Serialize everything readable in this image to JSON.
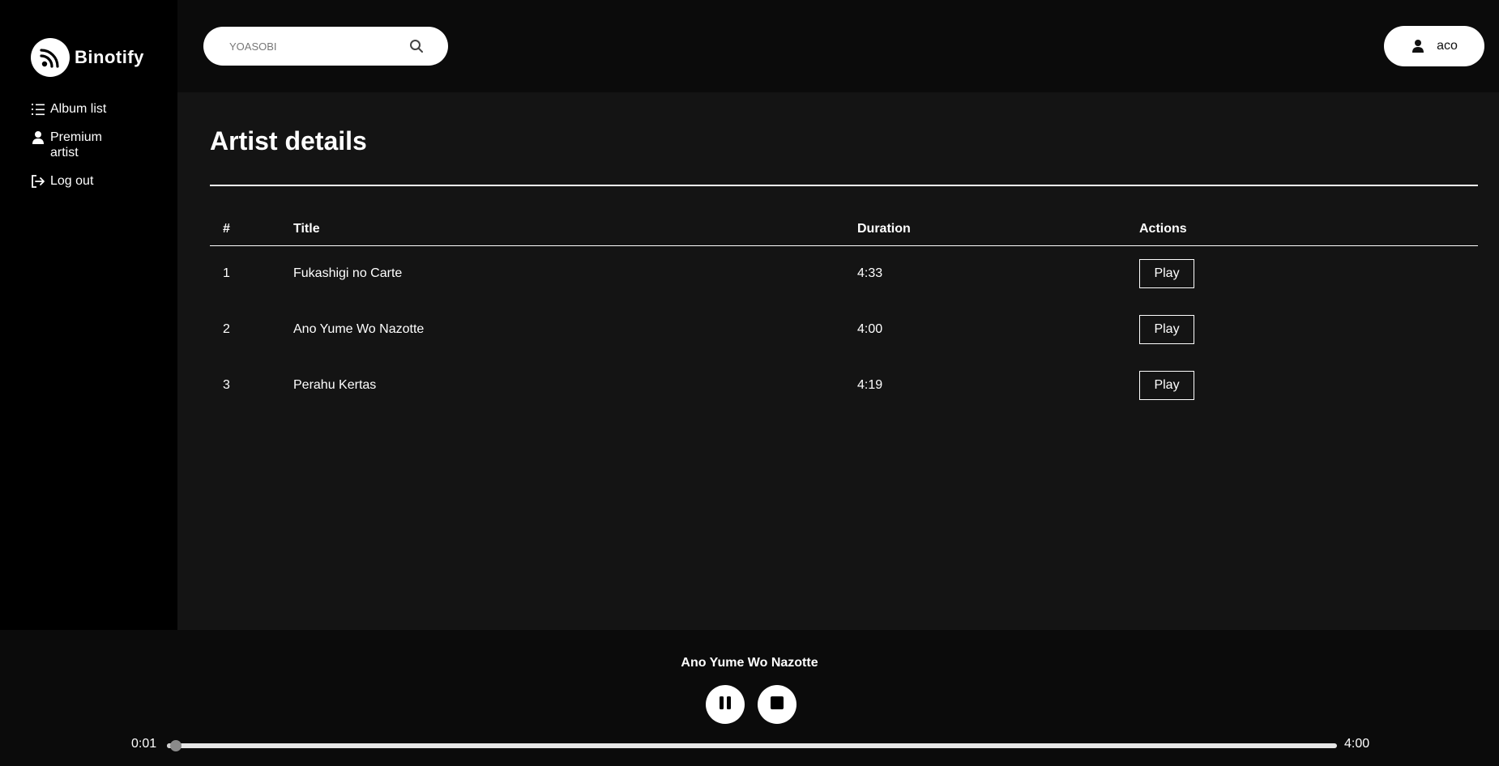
{
  "app": {
    "name": "Binotify",
    "logo_icon": "rss-disc-icon"
  },
  "sidebar": {
    "items": [
      {
        "label": "Album list",
        "icon": "list-icon"
      },
      {
        "label": "Premium artist",
        "icon": "user-icon"
      },
      {
        "label": "Log out",
        "icon": "logout-icon"
      }
    ]
  },
  "topbar": {
    "search": {
      "placeholder": "YOASOBI",
      "value": "",
      "icon": "search-icon"
    },
    "user": {
      "name": "aco",
      "icon": "user-icon"
    }
  },
  "main": {
    "title": "Artist details",
    "table": {
      "headers": {
        "num": "#",
        "title": "Title",
        "duration": "Duration",
        "actions": "Actions"
      },
      "rows": [
        {
          "num": "1",
          "title": "Fukashigi no Carte",
          "duration": "4:33",
          "action": "Play"
        },
        {
          "num": "2",
          "title": "Ano Yume Wo Nazotte",
          "duration": "4:00",
          "action": "Play"
        },
        {
          "num": "3",
          "title": "Perahu Kertas",
          "duration": "4:19",
          "action": "Play"
        }
      ]
    }
  },
  "player": {
    "now_playing": "Ano Yume Wo Nazotte",
    "current_time": "0:01",
    "total_time": "4:00",
    "progress": 0.004,
    "controls": {
      "pause_icon": "pause-icon",
      "stop_icon": "stop-icon"
    }
  },
  "colors": {
    "background": "#141414",
    "sidebar": "#000000",
    "topbar": "#0b0b0b",
    "accent": "#ffffff"
  }
}
